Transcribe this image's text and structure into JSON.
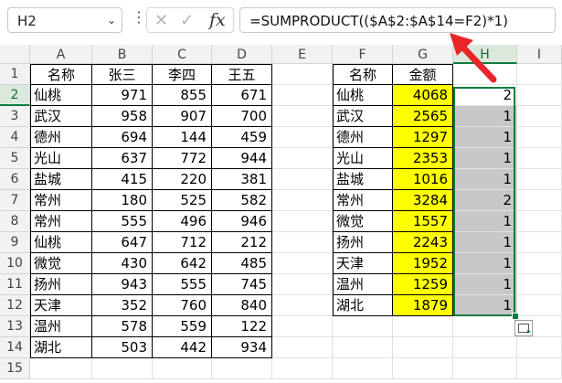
{
  "formula_bar": {
    "name_box": "H2",
    "formula": "=SUMPRODUCT(($A$2:$A$14=F2)*1)",
    "fx_label": "fx"
  },
  "columns": [
    "A",
    "B",
    "C",
    "D",
    "E",
    "F",
    "G",
    "H",
    "I"
  ],
  "rows": [
    "1",
    "2",
    "3",
    "4",
    "5",
    "6",
    "7",
    "8",
    "9",
    "10",
    "11",
    "12",
    "13",
    "14",
    "15"
  ],
  "table1": {
    "headers": [
      "名称",
      "张三",
      "李四",
      "王五"
    ],
    "rows": [
      [
        "仙桃",
        "971",
        "855",
        "671"
      ],
      [
        "武汉",
        "958",
        "907",
        "700"
      ],
      [
        "德州",
        "694",
        "144",
        "459"
      ],
      [
        "光山",
        "637",
        "772",
        "944"
      ],
      [
        "盐城",
        "415",
        "220",
        "381"
      ],
      [
        "常州",
        "180",
        "525",
        "582"
      ],
      [
        "常州",
        "555",
        "496",
        "946"
      ],
      [
        "仙桃",
        "647",
        "712",
        "212"
      ],
      [
        "微觉",
        "430",
        "642",
        "485"
      ],
      [
        "扬州",
        "943",
        "555",
        "745"
      ],
      [
        "天津",
        "352",
        "760",
        "840"
      ],
      [
        "温州",
        "578",
        "559",
        "122"
      ],
      [
        "湖北",
        "503",
        "442",
        "934"
      ]
    ]
  },
  "table2": {
    "headers": [
      "名称",
      "金额"
    ],
    "rows": [
      [
        "仙桃",
        "4068",
        "2"
      ],
      [
        "武汉",
        "2565",
        "1"
      ],
      [
        "德州",
        "1297",
        "1"
      ],
      [
        "光山",
        "2353",
        "1"
      ],
      [
        "盐城",
        "1016",
        "1"
      ],
      [
        "常州",
        "3284",
        "2"
      ],
      [
        "微觉",
        "1557",
        "1"
      ],
      [
        "扬州",
        "2243",
        "1"
      ],
      [
        "天津",
        "1952",
        "1"
      ],
      [
        "温州",
        "1259",
        "1"
      ],
      [
        "湖北",
        "1879",
        "1"
      ]
    ]
  },
  "colors": {
    "highlight_yellow": "#ffff00",
    "highlight_gray": "#c8c8c8",
    "selection_green": "#107c41",
    "annotation_red": "#e8262a"
  },
  "icons": [
    "chevron-down-icon",
    "more-options-icon",
    "cancel-icon",
    "enter-icon",
    "insert-function-icon",
    "quick-analysis-icon"
  ]
}
